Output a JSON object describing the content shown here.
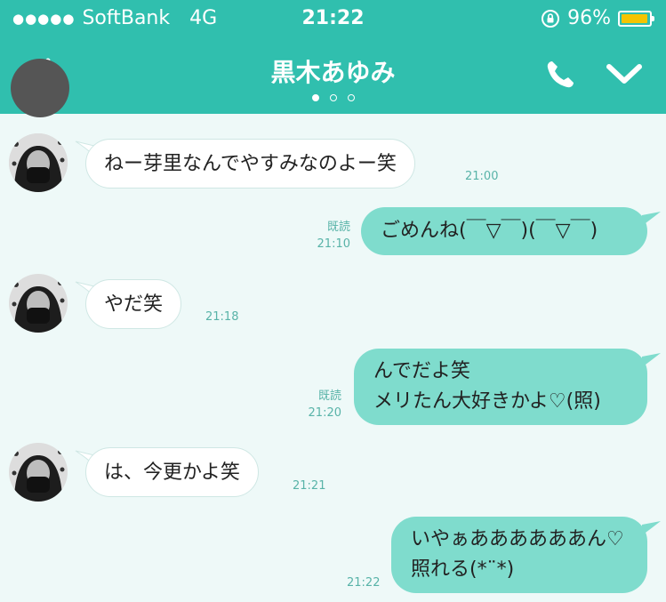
{
  "status_bar": {
    "signal_dots": "●●●●●",
    "carrier": "SoftBank",
    "network": "4G",
    "time": "21:22",
    "battery_percent": "96%",
    "battery_level": 0.96
  },
  "header": {
    "title": "黒木あゆみ",
    "page_count": 3,
    "active_page": 1
  },
  "messages": [
    {
      "direction": "in",
      "lines": [
        "ねー芽里なんでやすみなのよー笑"
      ],
      "time": "21:00"
    },
    {
      "direction": "out",
      "lines": [
        "ごめんね(￣▽￣)(￣▽￣)"
      ],
      "read": "既読",
      "time": "21:10"
    },
    {
      "direction": "in",
      "lines": [
        "やだ笑"
      ],
      "time": "21:18"
    },
    {
      "direction": "out",
      "lines": [
        "んでだよ笑",
        "メリたん大好きかよ♡(照)"
      ],
      "read": "既読",
      "time": "21:20"
    },
    {
      "direction": "in",
      "lines": [
        "は、今更かよ笑"
      ],
      "time": "21:21"
    },
    {
      "direction": "out",
      "lines": [
        "いやぁああああああん♡",
        "照れる(*¨*)"
      ],
      "time": "21:22"
    }
  ],
  "colors": {
    "header": "#30bfae",
    "background": "#eef9f8",
    "outgoing_bubble": "#7fdccd",
    "incoming_bubble": "#ffffff",
    "meta_text": "#58b3a8",
    "battery": "#f5c400"
  },
  "icons": {
    "back": "arrow-left-icon",
    "call": "phone-icon",
    "menu": "chevron-down-icon",
    "orientation_lock": "rotation-lock-icon"
  }
}
